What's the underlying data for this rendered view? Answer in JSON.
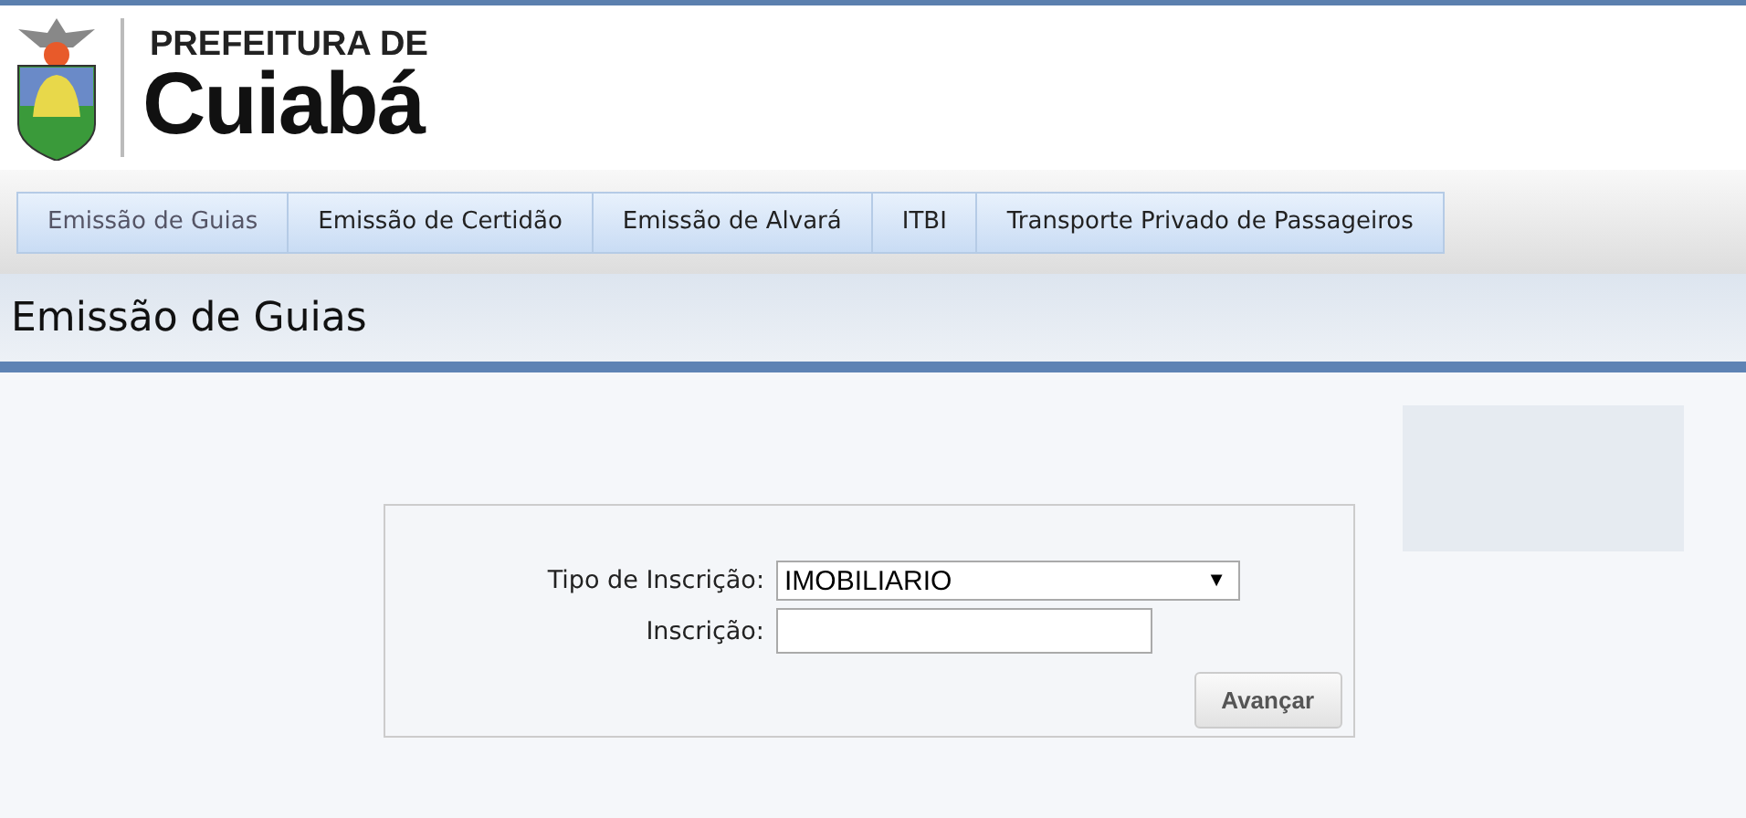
{
  "header": {
    "logo_line_1": "PREFEITURA DE",
    "logo_line_2": "Cuiabá"
  },
  "tabs": [
    {
      "label": "Emissão de Guias",
      "selected": true
    },
    {
      "label": "Emissão de Certidão",
      "selected": false
    },
    {
      "label": "Emissão de Alvará",
      "selected": false
    },
    {
      "label": "ITBI",
      "selected": false
    },
    {
      "label": "Transporte Privado de Passageiros",
      "selected": false
    }
  ],
  "page_title": "Emissão de Guias",
  "form": {
    "tipo_label": "Tipo de Inscrição:",
    "tipo_value": "IMOBILIARIO",
    "tipo_caret": "▼",
    "inscricao_label": "Inscrição:",
    "submit": "Avançar"
  }
}
